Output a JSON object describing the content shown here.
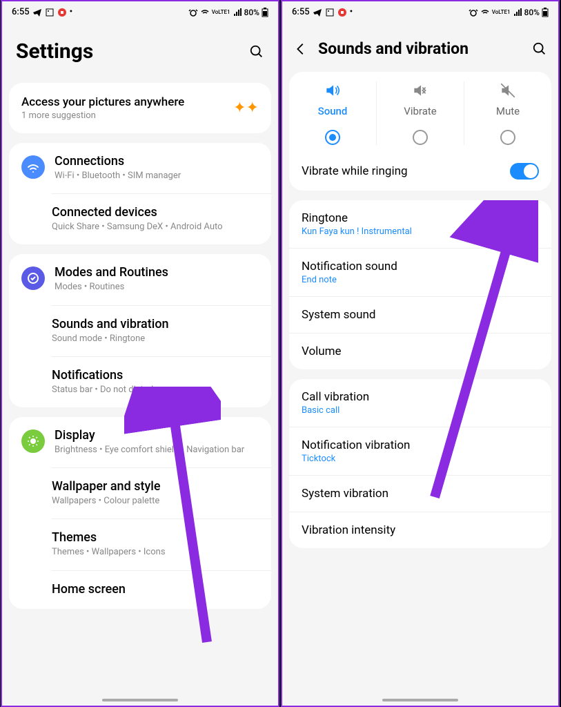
{
  "status": {
    "time": "6:55",
    "battery": "80%",
    "net": "VoLTE1"
  },
  "screen1": {
    "title": "Settings",
    "suggestion": {
      "title": "Access your pictures anywhere",
      "sub": "1 more suggestion"
    },
    "groups": [
      {
        "items": [
          {
            "icon": "wifi",
            "bg": "#4a8cff",
            "title": "Connections",
            "sub": "Wi-Fi • Bluetooth • SIM manager"
          },
          {
            "icon": "devices",
            "bg": "#4a8cff",
            "title": "Connected devices",
            "sub": "Quick Share • Samsung DeX • Android Auto"
          }
        ]
      },
      {
        "items": [
          {
            "icon": "routine",
            "bg": "#5a5ae6",
            "title": "Modes and Routines",
            "sub": "Modes • Routines"
          },
          {
            "icon": "sound",
            "bg": "#9a7aff",
            "title": "Sounds and vibration",
            "sub": "Sound mode • Ringtone"
          },
          {
            "icon": "notif",
            "bg": "#ff6b5a",
            "title": "Notifications",
            "sub": "Status bar • Do not disturb"
          }
        ]
      },
      {
        "items": [
          {
            "icon": "display",
            "bg": "#7acc3e",
            "title": "Display",
            "sub": "Brightness • Eye comfort shield • Navigation bar"
          },
          {
            "icon": "wallpaper",
            "bg": "#ff6b9a",
            "title": "Wallpaper and style",
            "sub": "Wallpapers • Colour palette"
          },
          {
            "icon": "themes",
            "bg": "#b87aff",
            "title": "Themes",
            "sub": "Themes • Wallpapers • Icons"
          },
          {
            "icon": "home",
            "bg": "#4acccc",
            "title": "Home screen",
            "sub": ""
          }
        ]
      }
    ]
  },
  "screen2": {
    "title": "Sounds and vibration",
    "modes": [
      {
        "label": "Sound",
        "active": true
      },
      {
        "label": "Vibrate",
        "active": false
      },
      {
        "label": "Mute",
        "active": false
      }
    ],
    "vibrate_ringing": "Vibrate while ringing",
    "items1": [
      {
        "title": "Ringtone",
        "sub": "Kun Faya kun ! Instrumental"
      },
      {
        "title": "Notification sound",
        "sub": "End note"
      },
      {
        "title": "System sound",
        "sub": ""
      },
      {
        "title": "Volume",
        "sub": ""
      }
    ],
    "items2": [
      {
        "title": "Call vibration",
        "sub": "Basic call"
      },
      {
        "title": "Notification vibration",
        "sub": "Ticktock"
      },
      {
        "title": "System vibration",
        "sub": ""
      },
      {
        "title": "Vibration intensity",
        "sub": ""
      }
    ]
  }
}
